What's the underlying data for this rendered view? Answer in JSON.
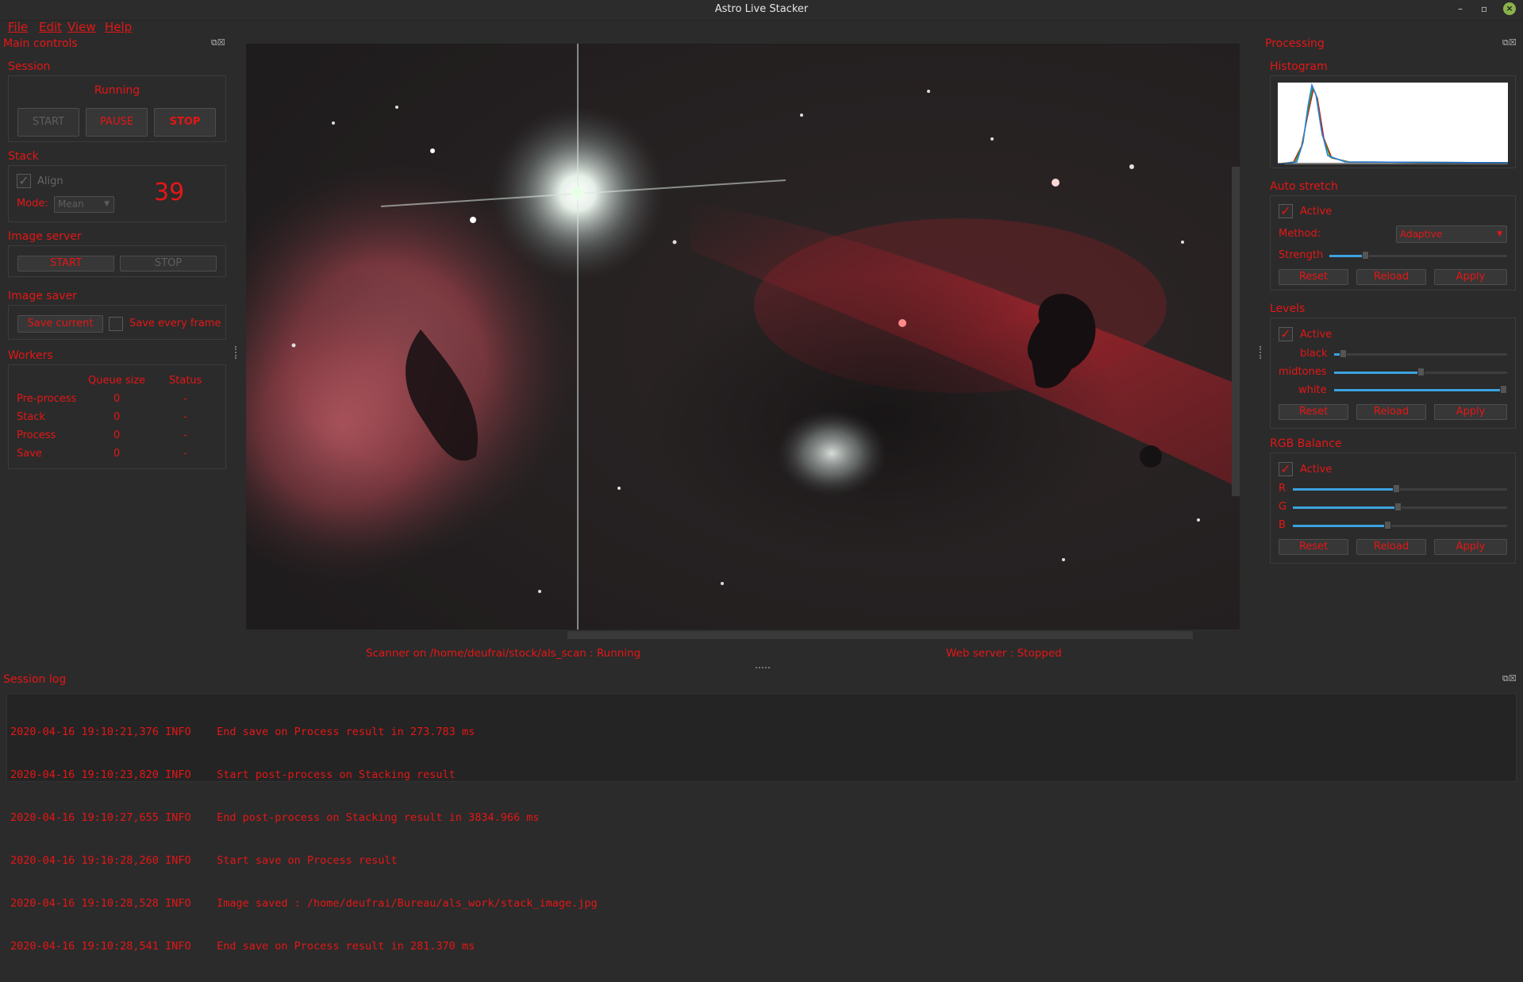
{
  "window": {
    "title": "Astro Live Stacker"
  },
  "menu": {
    "file": "File",
    "edit": "Edit",
    "view": "View",
    "help": "Help"
  },
  "main_controls": {
    "title": "Main controls",
    "session": {
      "label": "Session",
      "status": "Running",
      "start": "START",
      "pause": "PAUSE",
      "stop": "STOP"
    },
    "stack": {
      "label": "Stack",
      "align": "Align",
      "mode_label": "Mode:",
      "mode_value": "Mean",
      "count": "39"
    },
    "image_server": {
      "label": "Image server",
      "start": "START",
      "stop": "STOP"
    },
    "image_saver": {
      "label": "Image saver",
      "save_current": "Save current",
      "save_every": "Save every frame"
    },
    "workers": {
      "label": "Workers",
      "col_queue": "Queue size",
      "col_status": "Status",
      "rows": [
        {
          "name": "Pre-process",
          "queue": "0",
          "status": "-"
        },
        {
          "name": "Stack",
          "queue": "0",
          "status": "-"
        },
        {
          "name": "Process",
          "queue": "0",
          "status": "-"
        },
        {
          "name": "Save",
          "queue": "0",
          "status": "-"
        }
      ]
    }
  },
  "status": {
    "scanner": "Scanner on /home/deufrai/stock/als_scan : Running",
    "webserver": "Web server : Stopped"
  },
  "processing": {
    "title": "Processing",
    "histogram": {
      "label": "Histogram"
    },
    "autostretch": {
      "label": "Auto stretch",
      "active": "Active",
      "method_label": "Method:",
      "method_value": "Adaptive",
      "strength_label": "Strength",
      "strength": 0.2,
      "reset": "Reset",
      "reload": "Reload",
      "apply": "Apply"
    },
    "levels": {
      "label": "Levels",
      "active": "Active",
      "black_label": "black",
      "midtones_label": "midtones",
      "white_label": "white",
      "black": 0.05,
      "midtones": 0.5,
      "white": 1.0,
      "reset": "Reset",
      "reload": "Reload",
      "apply": "Apply"
    },
    "rgb": {
      "label": "RGB Balance",
      "active": "Active",
      "r_label": "R",
      "g_label": "G",
      "b_label": "B",
      "r": 0.48,
      "g": 0.49,
      "b": 0.44,
      "reset": "Reset",
      "reload": "Reload",
      "apply": "Apply"
    }
  },
  "session_log": {
    "title": "Session log",
    "lines": [
      "2020-04-16 19:10:21,376 INFO    End save on Process result in 273.783 ms",
      "2020-04-16 19:10:23,820 INFO    Start post-process on Stacking result",
      "2020-04-16 19:10:27,655 INFO    End post-process on Stacking result in 3834.966 ms",
      "2020-04-16 19:10:28,260 INFO    Start save on Process result",
      "2020-04-16 19:10:28,528 INFO    Image saved : /home/deufrai/Bureau/als_work/stack_image.jpg",
      "2020-04-16 19:10:28,541 INFO    End save on Process result in 281.370 ms"
    ]
  },
  "colors": {
    "accent": "#e51616",
    "background": "#2b2b2b",
    "slider": "#3ba3e0"
  }
}
